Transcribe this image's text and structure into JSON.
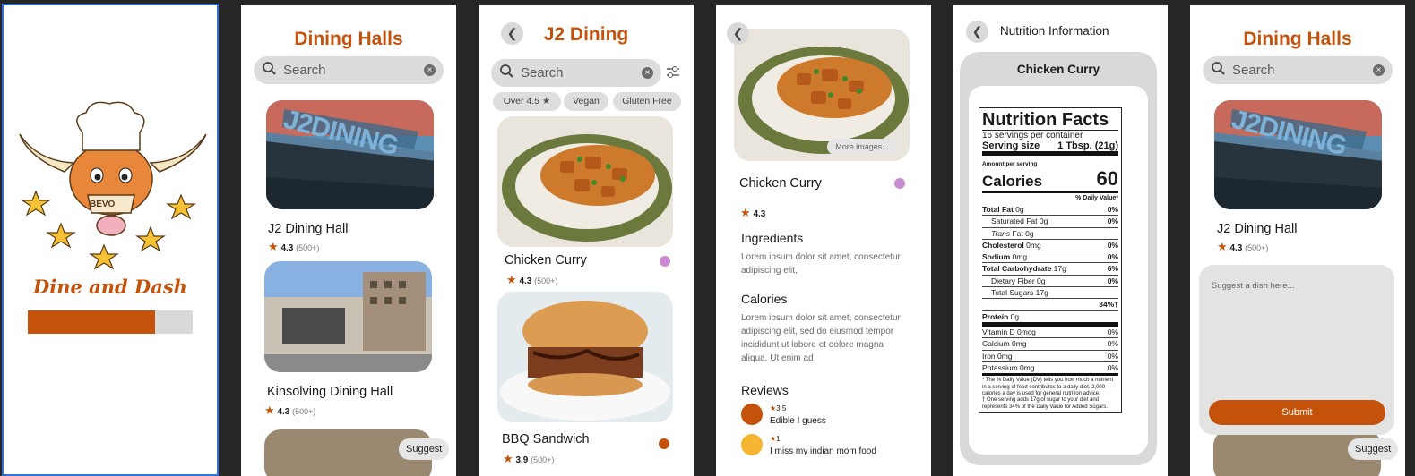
{
  "splash": {
    "logo_text": "BEVO",
    "app_name": "Dine and Dash",
    "progress": 0.77
  },
  "halls": {
    "title": "Dining Halls",
    "search_placeholder": "Search",
    "items": [
      {
        "name": "J2 Dining Hall",
        "rating": "4.3",
        "count": "(500+)",
        "sign": "J2DINING"
      },
      {
        "name": "Kinsolving Dining Hall",
        "rating": "4.3",
        "count": "(500+)"
      }
    ],
    "suggest_label": "Suggest"
  },
  "j2": {
    "title": "J2 Dining",
    "search_placeholder": "Search",
    "chips": [
      "Over 4.5",
      "Vegan",
      "Gluten Free"
    ],
    "items": [
      {
        "name": "Chicken Curry",
        "rating": "4.3",
        "count": "(500+)",
        "badge_color": "#c98bd1"
      },
      {
        "name": "BBQ Sandwich",
        "rating": "3.9",
        "count": "(500+)",
        "badge_color": "#c4520a"
      }
    ]
  },
  "dish": {
    "more_images": "More images...",
    "name": "Chicken Curry",
    "rating": "4.3",
    "ingredients_heading": "Ingredients",
    "ingredients_text": "Lorem ipsum dolor sit amet, consectetur adipiscing elit,",
    "calories_heading": "Calories",
    "calories_text": "Lorem ipsum dolor sit amet, consectetur adipiscing elit, sed do eiusmod tempor incididunt ut labore et dolore magna aliqua. Ut enim ad",
    "reviews_heading": "Reviews",
    "reviews": [
      {
        "stars": "3.5",
        "text": "Edible I guess",
        "avatar_color": "#c4520a"
      },
      {
        "stars": "1",
        "text": "I miss my indian mom food",
        "avatar_color": "#f5b731"
      }
    ]
  },
  "nutrition": {
    "title": "Nutrition Information",
    "dish_name": "Chicken Curry",
    "label_title": "Nutrition Facts",
    "servings": "16 servings per container",
    "serving_size_label": "Serving size",
    "serving_size_value": "1 Tbsp. (21g)",
    "amount_per_serving": "Amount per serving",
    "calories_label": "Calories",
    "calories_value": "60",
    "dv_header": "% Daily Value*",
    "rows": [
      {
        "label": "Total Fat",
        "amount": "0g",
        "dv": "0%",
        "bold": true
      },
      {
        "label": "Saturated Fat",
        "amount": "0g",
        "dv": "0%",
        "indent": 1
      },
      {
        "label": "Trans",
        "amount": "Fat 0g",
        "dv": "",
        "indent": 1,
        "italic": true
      },
      {
        "label": "Cholesterol",
        "amount": "0mg",
        "dv": "0%",
        "bold": true
      },
      {
        "label": "Sodium",
        "amount": "0mg",
        "dv": "0%",
        "bold": true
      },
      {
        "label": "Total Carbohydrate",
        "amount": "17g",
        "dv": "6%",
        "bold": true
      },
      {
        "label": "Dietary Fiber",
        "amount": "0g",
        "dv": "0%",
        "indent": 1
      },
      {
        "label": "Total Sugars",
        "amount": "17g",
        "dv": "",
        "indent": 1
      },
      {
        "label": "",
        "amount": "",
        "dv": "34%†",
        "indent": 2
      },
      {
        "label": "Protein",
        "amount": "0g",
        "dv": "",
        "bold": true
      }
    ],
    "vitamins": [
      {
        "label": "Vitamin D 0mcg",
        "dv": "0%"
      },
      {
        "label": "Calcium 0mg",
        "dv": "0%"
      },
      {
        "label": "Iron 0mg",
        "dv": "0%"
      },
      {
        "label": "Potassium 0mg",
        "dv": "0%"
      }
    ],
    "footnote1": "* The % Daily Value (DV) tells you how much a nutrient in a serving of food contributes to a daily diet. 2,000 calories a day is used for general nutrition advice.",
    "footnote2": "† One serving adds 17g of sugar to your diet and represents 34% of the Daily Value for Added Sugars."
  },
  "suggest_screen": {
    "title": "Dining Halls",
    "search_placeholder": "Search",
    "hall_name": "J2 Dining Hall",
    "rating": "4.3",
    "count": "(500+)",
    "placeholder": "Suggest a dish here...",
    "submit_label": "Submit",
    "suggest_label": "Suggest"
  },
  "colors": {
    "accent": "#c4520a",
    "field": "#dcdcdc",
    "background": "#262626"
  }
}
